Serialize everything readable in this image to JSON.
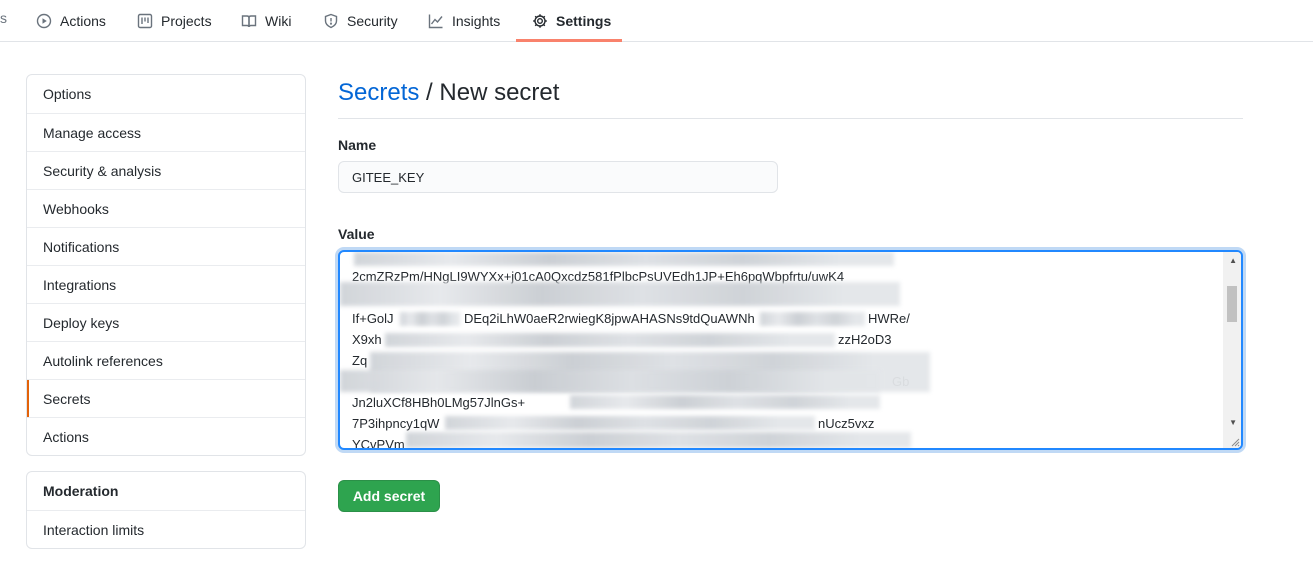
{
  "nav": {
    "partial_tab": "s",
    "tabs": [
      {
        "label": "Actions",
        "icon": "play-circle-icon"
      },
      {
        "label": "Projects",
        "icon": "project-board-icon"
      },
      {
        "label": "Wiki",
        "icon": "book-icon"
      },
      {
        "label": "Security",
        "icon": "shield-icon"
      },
      {
        "label": "Insights",
        "icon": "graph-icon"
      },
      {
        "label": "Settings",
        "icon": "gear-icon",
        "active": true
      }
    ],
    "active_color": "#f9826c"
  },
  "sidebar": {
    "items": [
      {
        "label": "Options"
      },
      {
        "label": "Manage access"
      },
      {
        "label": "Security & analysis"
      },
      {
        "label": "Webhooks"
      },
      {
        "label": "Notifications"
      },
      {
        "label": "Integrations"
      },
      {
        "label": "Deploy keys"
      },
      {
        "label": "Autolink references"
      },
      {
        "label": "Secrets",
        "selected": true
      },
      {
        "label": "Actions"
      }
    ],
    "moderation": {
      "heading": "Moderation",
      "items": [
        {
          "label": "Interaction limits"
        }
      ]
    }
  },
  "main": {
    "breadcrumb_link": "Secrets",
    "breadcrumb_sep": " / ",
    "breadcrumb_current": "New secret",
    "name_label": "Name",
    "name_value": "GITEE_KEY",
    "value_label": "Value",
    "value_visible_lines": [
      "2cmZRzPm/HNgLI9WYXx+j01cA0Qxcdz581fPlbcPsUVEdh1JP+Eh6pqWbpfrtu/uwK4",
      "If+GolJ",
      "X9xh",
      "Zq",
      "Jn2luXCf8HBh0LMg57JlnGs+",
      "7P3ihpncy1qW",
      "YCvPVm"
    ],
    "value_line_fragments": [
      {
        "text": "DEq2iLhW0aeR2rwiegK8jpwAHASNs9tdQuAWNh",
        "line": 1
      },
      {
        "text": "HWRe/",
        "line": 1
      },
      {
        "text": "zzH2oD3",
        "line": 2
      },
      {
        "text": "Gb",
        "line": 3
      },
      {
        "text": "nUcz5vxz",
        "line": 5
      }
    ],
    "add_button_label": "Add secret",
    "add_button_color": "#2ea44f"
  }
}
